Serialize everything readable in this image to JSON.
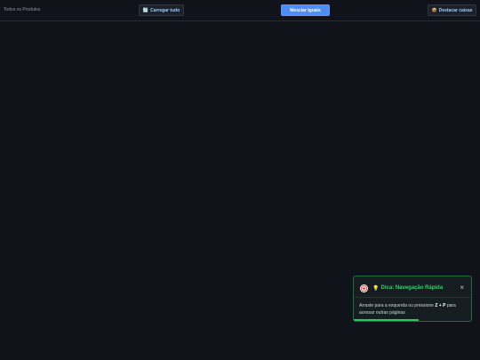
{
  "header": {
    "title": "Todos os Produtos",
    "load_all": {
      "icon": "refresh-icon",
      "label": "Carregar tudo"
    },
    "merge_equal": {
      "label": "Mesclar Iguais"
    },
    "highlight_boxes": {
      "icon": "package-icon",
      "label": "Destacar caixas"
    }
  },
  "toast": {
    "icon": "target-icon",
    "title_icon": "bulb-icon",
    "title": "Dica: Navegação Rápida",
    "body_prefix": "Arraste para a esquerda ou pressione ",
    "body_keys": "Z + P",
    "body_suffix": " para acessar outras páginas",
    "progress": 0.55,
    "close": "×"
  },
  "colors": {
    "background": "#10141a",
    "primary_button": "#4d8df7",
    "toast_accent": "#33d36a",
    "toast_border": "#1f6e3d"
  }
}
